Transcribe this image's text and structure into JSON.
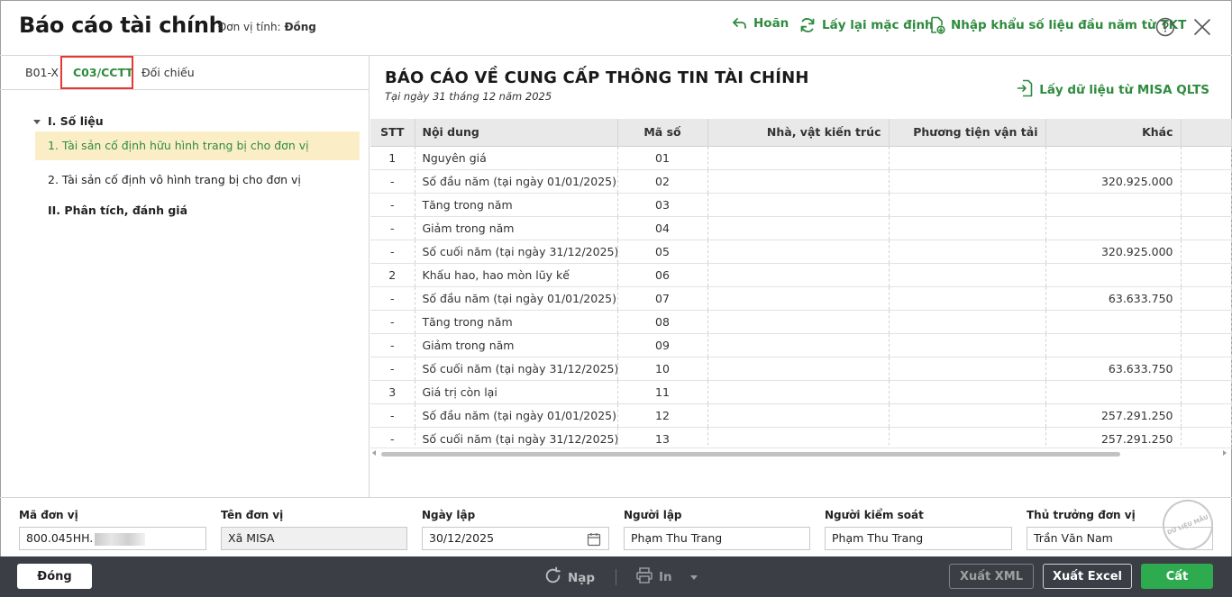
{
  "header": {
    "title": "Báo cáo tài chính",
    "unit_label": "Đơn vị tính:",
    "unit_value": "Đồng",
    "undo_label": "Hoãn",
    "reset_label": "Lấy lại mặc định",
    "import_label": "Nhập khẩu số liệu đầu năm từ TKT"
  },
  "tabs": [
    {
      "label": "B01-X"
    },
    {
      "label": "C03/CCTT"
    },
    {
      "label": "Đối chiếu"
    }
  ],
  "tree": {
    "group1": "I. Số liệu",
    "item1": "1. Tài sản cố định hữu hình trang bị cho đơn vị",
    "item2": "2. Tài sản cố định vô hình trang bị cho đơn vị",
    "group2": "II. Phân tích, đánh giá"
  },
  "report": {
    "title": "BÁO CÁO VỀ CUNG CẤP THÔNG TIN TÀI CHÍNH",
    "date": "Tại ngày 31 tháng 12 năm 2025",
    "fetch_label": "Lấy dữ liệu từ MISA QLTS"
  },
  "table": {
    "headers": {
      "stt": "STT",
      "content": "Nội dung",
      "code": "Mã số",
      "building": "Nhà, vật kiến trúc",
      "vehicle": "Phương tiện vận tải",
      "other": "Khác"
    },
    "rows": [
      {
        "stt": "1",
        "content": "Nguyên giá",
        "code": "01",
        "building": "",
        "vehicle": "",
        "other": "",
        "indent": false
      },
      {
        "stt": "-",
        "content": "Số đầu năm (tại ngày 01/01/2025)",
        "code": "02",
        "building": "",
        "vehicle": "",
        "other": "320.925.000",
        "indent": false
      },
      {
        "stt": "-",
        "content": "Tăng trong năm",
        "code": "03",
        "building": "",
        "vehicle": "",
        "other": "",
        "indent": true
      },
      {
        "stt": "-",
        "content": "Giảm trong năm",
        "code": "04",
        "building": "",
        "vehicle": "",
        "other": "",
        "indent": true
      },
      {
        "stt": "-",
        "content": "Số cuối năm (tại ngày 31/12/2025)",
        "code": "05",
        "building": "",
        "vehicle": "",
        "other": "320.925.000",
        "indent": false
      },
      {
        "stt": "2",
        "content": "Khấu hao, hao mòn lũy kế",
        "code": "06",
        "building": "",
        "vehicle": "",
        "other": "",
        "indent": false
      },
      {
        "stt": "-",
        "content": "Số đầu năm (tại ngày 01/01/2025)",
        "code": "07",
        "building": "",
        "vehicle": "",
        "other": "63.633.750",
        "indent": false
      },
      {
        "stt": "-",
        "content": "Tăng trong năm",
        "code": "08",
        "building": "",
        "vehicle": "",
        "other": "",
        "indent": true
      },
      {
        "stt": "-",
        "content": "Giảm trong năm",
        "code": "09",
        "building": "",
        "vehicle": "",
        "other": "",
        "indent": true
      },
      {
        "stt": "-",
        "content": "Số cuối năm (tại ngày 31/12/2025)",
        "code": "10",
        "building": "",
        "vehicle": "",
        "other": "63.633.750",
        "indent": false
      },
      {
        "stt": "3",
        "content": "Giá trị còn lại",
        "code": "11",
        "building": "",
        "vehicle": "",
        "other": "",
        "indent": false
      },
      {
        "stt": "-",
        "content": "Số đầu năm (tại ngày 01/01/2025)",
        "code": "12",
        "building": "",
        "vehicle": "",
        "other": "257.291.250",
        "indent": false
      },
      {
        "stt": "-",
        "content": "Số cuối năm (tại ngày 31/12/2025)",
        "code": "13",
        "building": "",
        "vehicle": "",
        "other": "257.291.250",
        "indent": false
      }
    ]
  },
  "info": {
    "unit_code_label": "Mã đơn vị",
    "unit_code_value": "800.045HH.",
    "unit_name_label": "Tên đơn vị",
    "unit_name_value": "Xã MISA",
    "date_label": "Ngày lập",
    "date_value": "30/12/2025",
    "creator_label": "Người lập",
    "creator_value": "Phạm Thu Trang",
    "controller_label": "Người kiểm soát",
    "controller_value": "Phạm Thu Trang",
    "head_label": "Thủ trưởng đơn vị",
    "head_value": "Trần Văn Nam",
    "stamp_text": "DỮ LIỆU MẪU"
  },
  "footer": {
    "close_label": "Đóng",
    "reload_label": "Nạp",
    "print_label": "In",
    "xml_label": "Xuất XML",
    "excel_label": "Xuất Excel",
    "save_label": "Cất"
  },
  "colors": {
    "accent_green": "#2e8b3e",
    "save_green": "#2eab4f",
    "selected_row": "#fbeec6",
    "highlight_red": "#e53935",
    "footer_bg": "#3b3e44"
  },
  "icons": [
    "undo-icon",
    "refresh-icon",
    "import-file-icon",
    "help-icon",
    "close-icon",
    "import-data-icon",
    "calendar-icon",
    "reload-icon",
    "printer-icon",
    "dropdown-icon"
  ]
}
